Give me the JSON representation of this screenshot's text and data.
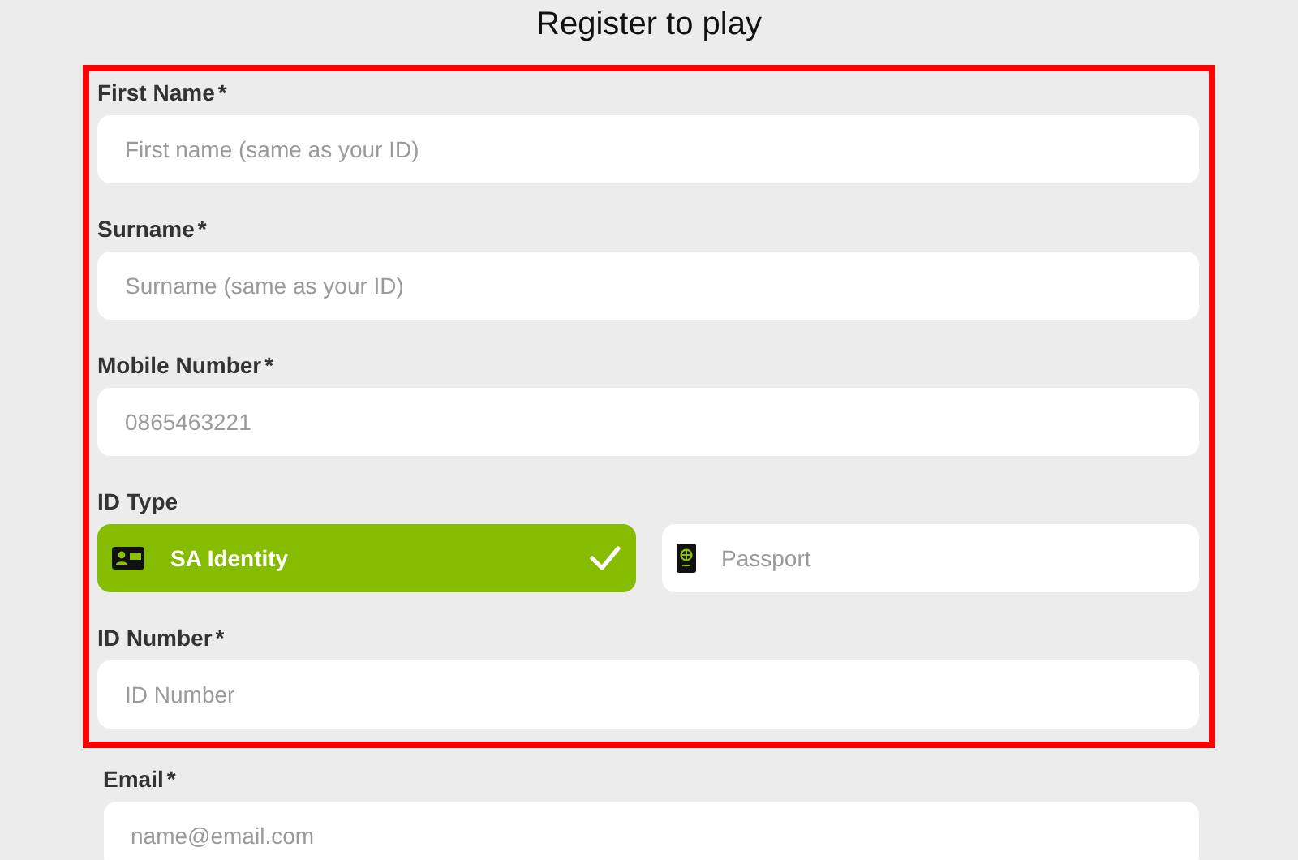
{
  "title": "Register to play",
  "highlighted_fields": [
    {
      "kind": "text",
      "label": "First Name",
      "required_mark": "*",
      "placeholder": "First name (same as your ID)"
    },
    {
      "kind": "text",
      "label": "Surname",
      "required_mark": "*",
      "placeholder": "Surname (same as your ID)"
    },
    {
      "kind": "text",
      "label": "Mobile Number",
      "required_mark": "*",
      "placeholder": "0865463221"
    },
    {
      "kind": "choice",
      "label": "ID Type",
      "options": [
        {
          "label": "SA Identity",
          "selected": true
        },
        {
          "label": "Passport",
          "selected": false
        }
      ]
    },
    {
      "kind": "text",
      "label": "ID Number",
      "required_mark": "*",
      "placeholder": "ID Number"
    }
  ],
  "other_fields": [
    {
      "kind": "text",
      "label": "Email",
      "required_mark": "*",
      "placeholder": "name@email.com"
    }
  ]
}
